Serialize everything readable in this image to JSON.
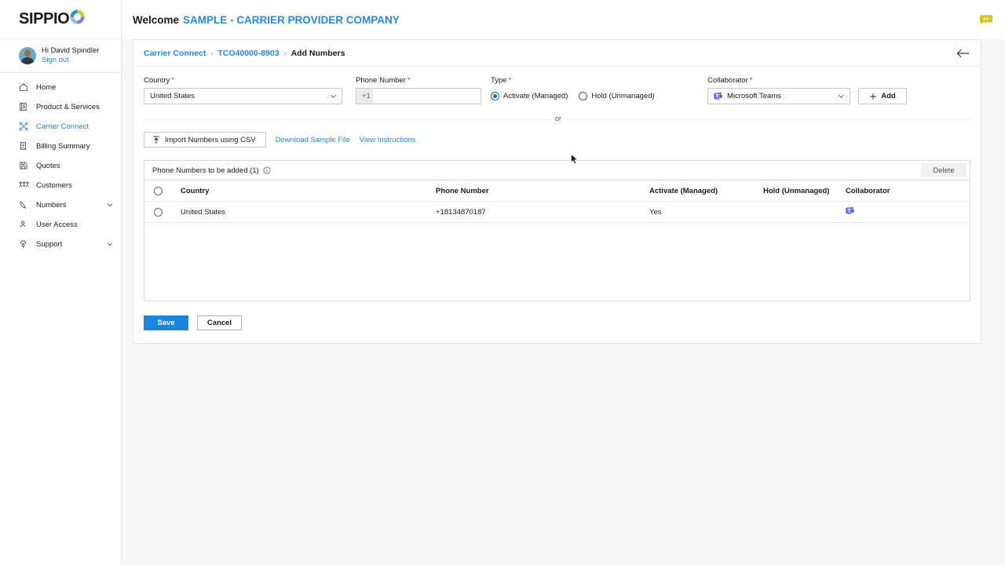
{
  "brand": {
    "logo_text": "SIPPIO",
    "logo_icon": "sippio-ring-icon",
    "accent_blue": "#2b88d8",
    "save_blue": "#1a86d9"
  },
  "sidebar": {
    "user": {
      "greeting": "Hi David Spindler",
      "signout_label": "Sign out",
      "avatar_icon": "avatar"
    },
    "items": [
      {
        "label": "Home",
        "icon": "home-icon",
        "active": false,
        "chevron": false
      },
      {
        "label": "Product & Services",
        "icon": "products-icon",
        "active": false,
        "chevron": false
      },
      {
        "label": "Carrier Connect",
        "icon": "carrier-connect-icon",
        "active": true,
        "chevron": false
      },
      {
        "label": "Billing Summary",
        "icon": "billing-icon",
        "active": false,
        "chevron": false
      },
      {
        "label": "Quotes",
        "icon": "quotes-icon",
        "active": false,
        "chevron": false
      },
      {
        "label": "Customers",
        "icon": "customers-icon",
        "active": false,
        "chevron": false
      },
      {
        "label": "Numbers",
        "icon": "phone-icon",
        "active": false,
        "chevron": true
      },
      {
        "label": "User Access",
        "icon": "user-access-icon",
        "active": false,
        "chevron": false
      },
      {
        "label": "Support",
        "icon": "support-headset-icon",
        "active": false,
        "chevron": true
      }
    ]
  },
  "topbar": {
    "welcome_label": "Welcome",
    "company_name": "SAMPLE - CARRIER PROVIDER COMPANY",
    "feedback_icon": "feedback-chat-icon"
  },
  "breadcrumb": {
    "items": [
      "Carrier Connect",
      "TCO40000-8903",
      "Add Numbers"
    ],
    "separator": "›",
    "back_icon": "back-arrow-icon"
  },
  "form": {
    "country": {
      "label": "Country",
      "required": "*",
      "value": "United States"
    },
    "phone": {
      "label": "Phone Number",
      "required": "*",
      "prefix": "+1",
      "value": "",
      "placeholder": ""
    },
    "type": {
      "label": "Type",
      "required": "*",
      "options": [
        {
          "label": "Activate (Managed)",
          "selected": true
        },
        {
          "label": "Hold (Unmanaged)",
          "selected": false
        }
      ]
    },
    "collaborator": {
      "label": "Collaborator",
      "required": "*",
      "value": "Microsoft Teams",
      "icon": "microsoft-teams-icon"
    },
    "add_button": {
      "label": "Add",
      "icon": "plus-icon"
    },
    "or_text": "or",
    "import_button": {
      "label": "Import Numbers using CSV",
      "icon": "upload-icon"
    },
    "links": [
      {
        "label": "Download Sample File"
      },
      {
        "label": "View Instructions"
      }
    ]
  },
  "table_panel": {
    "title": "Phone Numbers to be added (1)",
    "info_icon": "info-icon",
    "delete_label": "Delete",
    "columns": [
      "Country",
      "Phone Number",
      "Activate (Managed)",
      "Hold (Unmanaged)",
      "Collaborator"
    ],
    "rows": [
      {
        "country": "United States",
        "phone_number": "+18134870187",
        "activate_managed": "Yes",
        "hold_unmanaged": "",
        "collaborator_icon": "microsoft-teams-icon"
      }
    ]
  },
  "actions": {
    "save_label": "Save",
    "cancel_label": "Cancel"
  }
}
